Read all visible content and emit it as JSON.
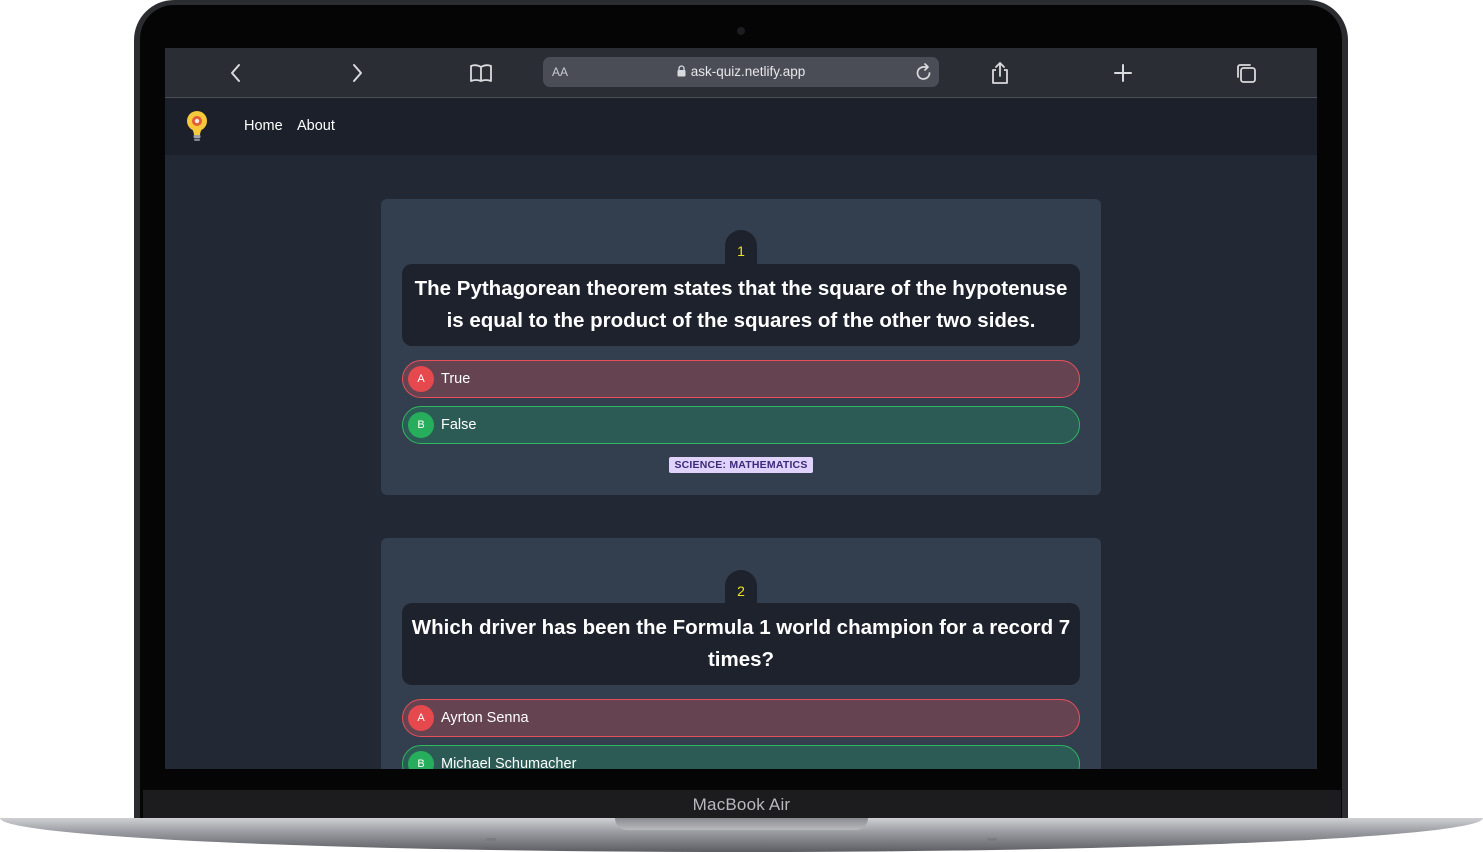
{
  "device": {
    "brand_label": "MacBook Air"
  },
  "browser": {
    "aa_label": "AA",
    "url": "ask-quiz.netlify.app"
  },
  "site_nav": {
    "links": [
      "Home",
      "About"
    ]
  },
  "questions": [
    {
      "number": "1",
      "text": "The Pythagorean theorem states that the square of the hypotenuse is equal to the product of the squares of the other two sides.",
      "options": [
        {
          "letter": "A",
          "text": "True",
          "state": "wrong"
        },
        {
          "letter": "B",
          "text": "False",
          "state": "right"
        }
      ],
      "category": "SCIENCE: MATHEMATICS"
    },
    {
      "number": "2",
      "text": "Which driver has been the Formula 1 world champion for a record 7 times?",
      "options": [
        {
          "letter": "A",
          "text": "Ayrton Senna",
          "state": "wrong"
        },
        {
          "letter": "B",
          "text": "Michael Schumacher",
          "state": "right"
        }
      ]
    }
  ],
  "colors": {
    "page_bg": "#222834",
    "card_bg": "#333f4f",
    "question_bg": "#1d222c",
    "number_color": "#f1e21b",
    "wrong_border": "#e7505a",
    "right_border": "#2fb661",
    "category_bg": "#e0d3fb"
  }
}
